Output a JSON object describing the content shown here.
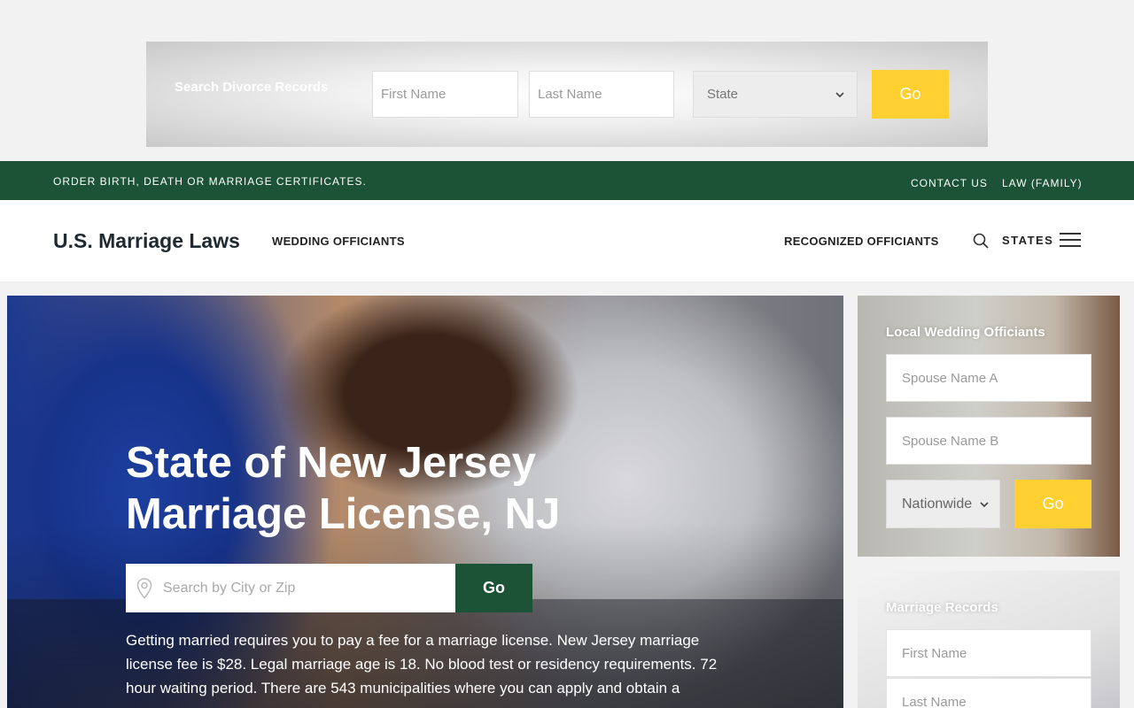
{
  "banner": {
    "title": "Search Divorce Records",
    "first_name_placeholder": "First Name",
    "last_name_placeholder": "Last Name",
    "state_value": "State",
    "go_label": "Go"
  },
  "topbar": {
    "left_text": "ORDER BIRTH, DEATH OR MARRIAGE CERTIFICATES.",
    "contact": "CONTACT US",
    "law": "LAW (FAMILY)"
  },
  "nav": {
    "logo": "U.S. Marriage Laws",
    "wedding_officiants": "WEDDING OFFICIANTS",
    "recognized_officiants": "RECOGNIZED OFFICIANTS",
    "states": "STATES"
  },
  "hero": {
    "title_line1": "State of New Jersey",
    "title_line2": "Marriage License, NJ",
    "search_placeholder": "Search by City or Zip",
    "go_label": "Go",
    "description": "Getting married requires you to pay a fee for a marriage license. New Jersey marriage license fee is $28. Legal marriage age is 18. No blood test or residency requirements. 72 hour waiting period. There are 543 municipalities where you can apply and obtain a"
  },
  "sidebar": {
    "officiants": {
      "title": "Local Wedding Officiants",
      "spouse_a_placeholder": "Spouse Name A",
      "spouse_b_placeholder": "Spouse Name B",
      "scope_value": "Nationwide",
      "go_label": "Go"
    },
    "records": {
      "title": "Marriage Records",
      "first_name_placeholder": "First Name",
      "last_name_placeholder": "Last Name"
    }
  },
  "colors": {
    "green": "#1c5235",
    "yellow": "#ffd02f"
  }
}
